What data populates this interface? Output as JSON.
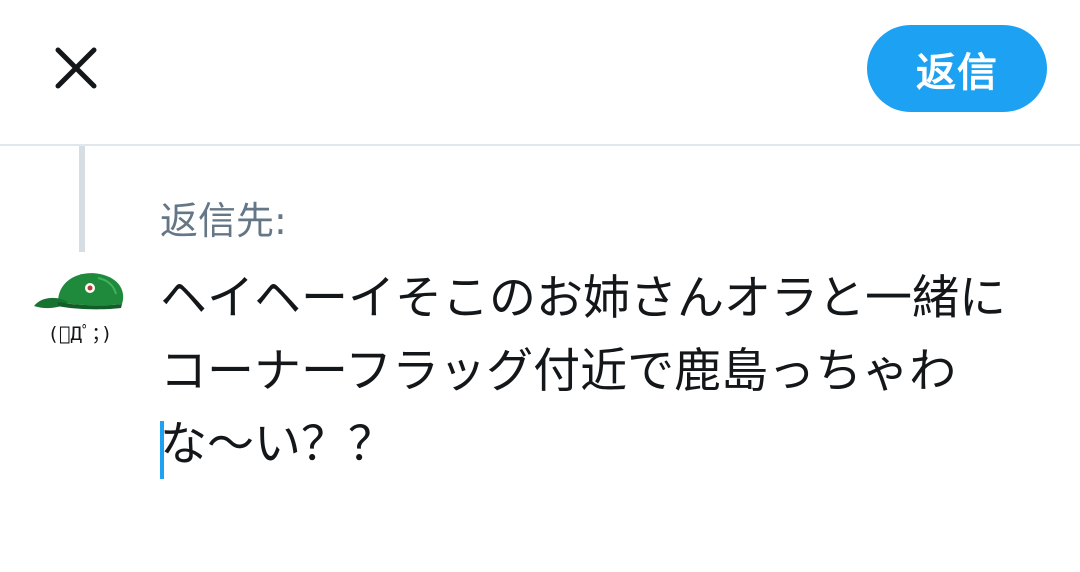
{
  "header": {
    "close_icon": "close-icon",
    "reply_button_label": "返信"
  },
  "compose": {
    "reply_to_label": "返信先:",
    "text": "ヘイヘーイそこのお姉さんオラと一緒にコーナーフラッグ付近で鹿島っちゃわな〜い？？"
  },
  "avatar": {
    "emoticon": "(ﾟДﾟ；)",
    "hat_color": "#1f8a3c"
  },
  "colors": {
    "accent": "#1da1f2",
    "muted_text": "#657786",
    "divider": "#e1e8ed"
  }
}
